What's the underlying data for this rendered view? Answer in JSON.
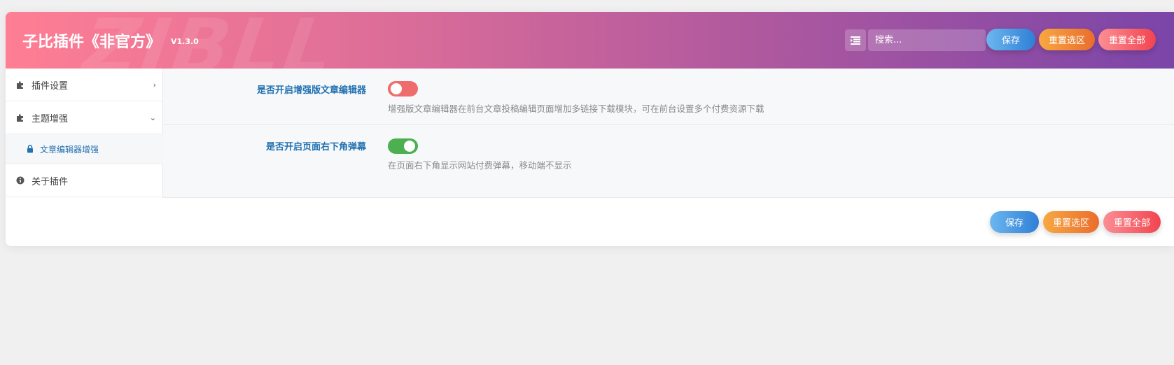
{
  "header": {
    "watermark": "ZIBLL",
    "title": "子比插件《非官方》",
    "version": "V1.3.0",
    "menu_icon": "list-icon",
    "search_placeholder": "搜索...",
    "save_label": "保存",
    "reset_section_label": "重置选区",
    "reset_all_label": "重置全部"
  },
  "sidebar": {
    "items": [
      {
        "label": "插件设置",
        "icon": "puzzle-icon",
        "arrow": "›"
      },
      {
        "label": "主题增强",
        "icon": "puzzle-icon",
        "arrow": "⌄"
      },
      {
        "label": "文章编辑器增强",
        "icon": "lock-icon"
      },
      {
        "label": "关于插件",
        "icon": "info-icon"
      }
    ]
  },
  "settings": [
    {
      "label": "是否开启增强版文章编辑器",
      "enabled": false,
      "description": "增强版文章编辑器在前台文章投稿编辑页面增加多链接下载模块，可在前台设置多个付费资源下载"
    },
    {
      "label": "是否开启页面右下角弹幕",
      "enabled": true,
      "description": "在页面右下角显示网站付费弹幕，移动端不显示"
    }
  ],
  "footer": {
    "save_label": "保存",
    "reset_section_label": "重置选区",
    "reset_all_label": "重置全部"
  },
  "colors": {
    "accent": "#2271b1",
    "toggle_off": "#ef6c6c",
    "toggle_on": "#4caf50"
  }
}
